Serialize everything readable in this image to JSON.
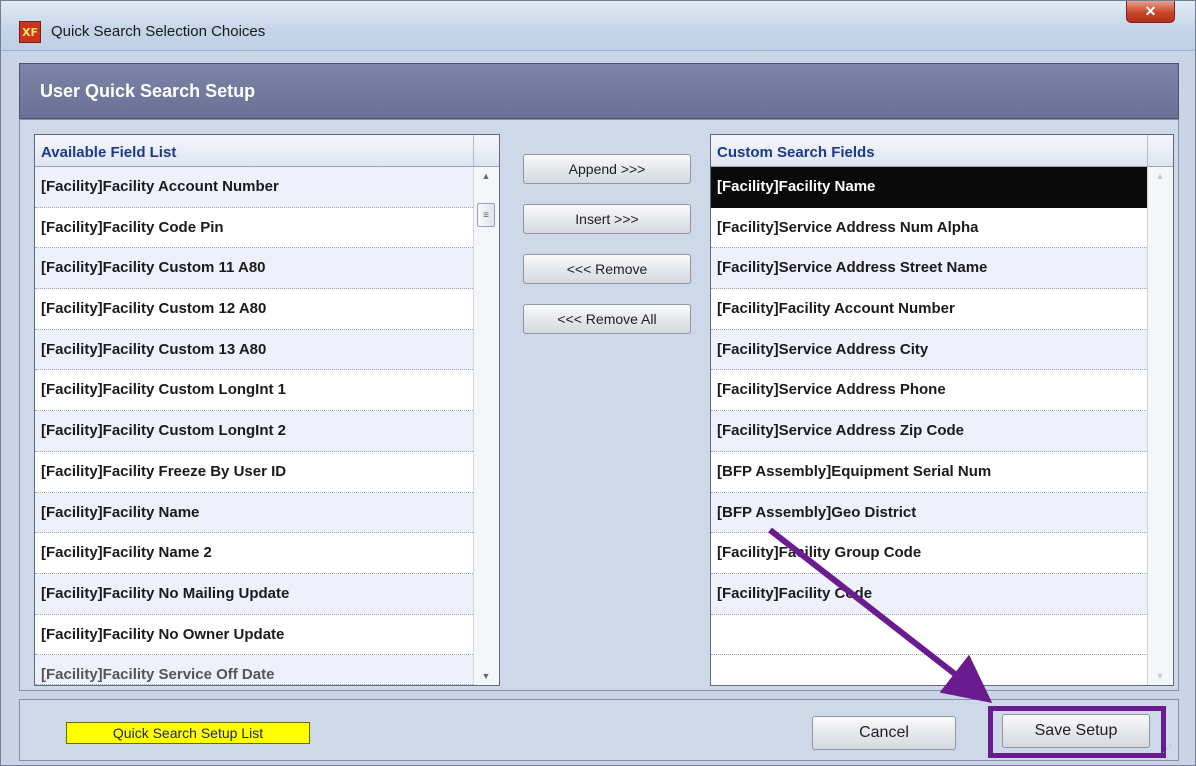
{
  "window": {
    "title": "Quick Search Selection Choices",
    "app_icon": "XF",
    "close_glyph": "✕"
  },
  "header": {
    "title": "User Quick Search Setup"
  },
  "available_list": {
    "header": "Available Field List",
    "items": [
      "[Facility]Facility Account Number",
      "[Facility]Facility Code Pin",
      "[Facility]Facility Custom 11 A80",
      "[Facility]Facility Custom 12 A80",
      "[Facility]Facility Custom 13 A80",
      "[Facility]Facility Custom LongInt 1",
      "[Facility]Facility Custom LongInt 2",
      "[Facility]Facility Freeze By User ID",
      "[Facility]Facility Name",
      "[Facility]Facility Name 2",
      "[Facility]Facility No Mailing Update",
      "[Facility]Facility No Owner Update",
      "[Facility]Facility Service Off Date"
    ]
  },
  "buttons": {
    "append": "Append >>>",
    "insert": "Insert >>>",
    "remove": "<<< Remove",
    "remove_all": "<<< Remove All",
    "cancel": "Cancel",
    "save": "Save Setup"
  },
  "custom_list": {
    "header": "Custom Search Fields",
    "selected_index": 0,
    "items": [
      "[Facility]Facility Name",
      "[Facility]Service Address Num Alpha",
      "[Facility]Service Address Street Name",
      "[Facility]Facility Account Number",
      "[Facility]Service Address City",
      "[Facility]Service Address Phone",
      "[Facility]Service Address Zip Code",
      "[BFP Assembly]Equipment Serial Num",
      "[BFP Assembly]Geo District",
      "[Facility]Facility Group Code",
      "[Facility]Facility Code"
    ]
  },
  "footer": {
    "label": "Quick Search Setup List"
  },
  "scroll": {
    "up": "▲",
    "down": "▼",
    "thumb": "≡"
  },
  "colors": {
    "highlight": "#6a1b8f",
    "selection": "#0a0a0a",
    "label_bg": "#ffff00",
    "header_band": "#6a7194"
  }
}
